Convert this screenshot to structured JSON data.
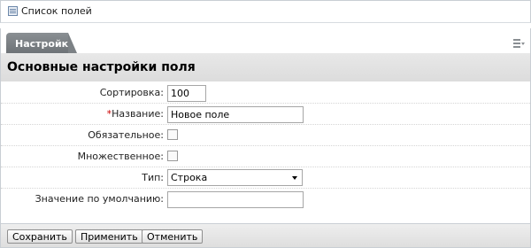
{
  "topbar": {
    "title": "Список полей",
    "icon": "list-icon"
  },
  "tabs": [
    {
      "label": "Настройки",
      "active": true
    }
  ],
  "section": {
    "title": "Основные настройки поля"
  },
  "form": {
    "sort": {
      "label": "Сортировка:",
      "value": "100"
    },
    "name": {
      "required_mark": "*",
      "label": "Название:",
      "value": "Новое поле"
    },
    "mandatory": {
      "label": "Обязательное:",
      "checked": false
    },
    "multiple": {
      "label": "Множественное:",
      "checked": false
    },
    "type": {
      "label": "Тип:",
      "selected": "Строка"
    },
    "default": {
      "label": "Значение по умолчанию:",
      "value": ""
    }
  },
  "footer": {
    "save_label": "Сохранить",
    "apply_label": "Применить",
    "cancel_label": "Отменить"
  }
}
